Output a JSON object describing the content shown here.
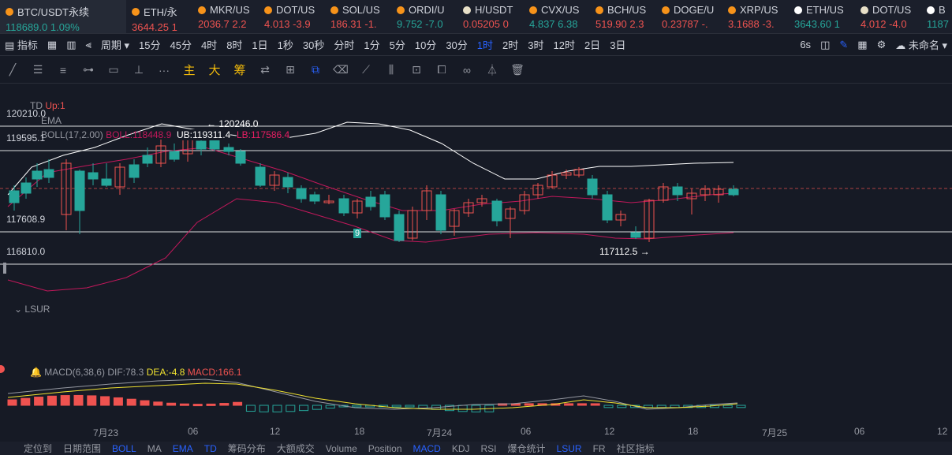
{
  "tickers": [
    {
      "name": "BTC/USDT永续",
      "price": "118689.0",
      "change": "1.09%",
      "dir": "up",
      "color": "#f7931a"
    },
    {
      "name": "ETH/永",
      "price": "3644.25",
      "change": "1",
      "dir": "dn",
      "color": "#f7931a"
    },
    {
      "name": "MKR/US",
      "price": "2036.7",
      "change": "2.2",
      "dir": "dn",
      "color": "#f7931a"
    },
    {
      "name": "DOT/US",
      "price": "4.013",
      "change": "-3.9",
      "dir": "dn",
      "color": "#f7931a"
    },
    {
      "name": "SOL/US",
      "price": "186.31",
      "change": "-1.",
      "dir": "dn",
      "color": "#f7931a"
    },
    {
      "name": "ORDI/U",
      "price": "9.752",
      "change": "-7.0",
      "dir": "up",
      "color": "#f7931a"
    },
    {
      "name": "H/USDT",
      "price": "0.05205",
      "change": "0",
      "dir": "dn",
      "color": "#e8e0c8"
    },
    {
      "name": "CVX/US",
      "price": "4.837",
      "change": "6.38",
      "dir": "up",
      "color": "#f7931a"
    },
    {
      "name": "BCH/US",
      "price": "519.90",
      "change": "2.3",
      "dir": "dn",
      "color": "#f7931a"
    },
    {
      "name": "DOGE/U",
      "price": "0.23787",
      "change": "-.",
      "dir": "dn",
      "color": "#f7931a"
    },
    {
      "name": "XRP/US",
      "price": "3.1688",
      "change": "-3.",
      "dir": "dn",
      "color": "#f7931a"
    },
    {
      "name": "ETH/US",
      "price": "3643.60",
      "change": "1",
      "dir": "up",
      "color": "#ffffff"
    },
    {
      "name": "DOT/US",
      "price": "4.012",
      "change": "-4.0",
      "dir": "dn",
      "color": "#e8e0c8"
    },
    {
      "name": "B",
      "price": "1187",
      "change": "",
      "dir": "up",
      "color": "#ffffff"
    }
  ],
  "toolbar": {
    "indicators": "指标",
    "period": "周期",
    "intervals": [
      "15分",
      "45分",
      "4时",
      "8时",
      "1日",
      "1秒",
      "30秒",
      "分时",
      "1分",
      "5分",
      "10分",
      "30分",
      "1时",
      "2时",
      "3时",
      "12时",
      "2日",
      "3日"
    ],
    "active_interval": "1时",
    "countdown": "6s",
    "layout_name": "未命名"
  },
  "drawing_tools": {
    "zh": [
      "主",
      "大",
      "筹"
    ]
  },
  "chart": {
    "price_labels": [
      "120210.0",
      "119595.1",
      "117608.9",
      "116810.0"
    ],
    "td_label": "TD",
    "td_value": "Up:1",
    "ema_label": "EMA",
    "boll_label": "BOLL(17,2.00)",
    "boll_text": "BOLL:118448.9",
    "ub": "UB:119311.4",
    "lb": "LB:117586.4",
    "high_annot": "← 120246.0",
    "low_annot": "117112.5 →",
    "td_count": "9",
    "lsur_label": "LSUR",
    "macd_label": "MACD(6,38,6)",
    "dif": "DIF:78.3",
    "dea": "DEA:-4.8",
    "macd": "MACD:166.1",
    "colors": {
      "up": "#26a69a",
      "down": "#ef5350",
      "boll_mid": "#c2185b",
      "boll_upper": "#ffffff",
      "dif": "#9598a1",
      "dea": "#f0e130"
    }
  },
  "x_axis": [
    "7月23",
    "06",
    "12",
    "18",
    "7月24",
    "06",
    "12",
    "18",
    "7月25",
    "06",
    "12"
  ],
  "bottom_tabs": [
    "定位到",
    "日期范围",
    "BOLL",
    "MA",
    "EMA",
    "TD",
    "筹码分布",
    "大额成交",
    "Volume",
    "Position",
    "MACD",
    "KDJ",
    "RSI",
    "爆仓统计",
    "LSUR",
    "FR",
    "社区指标"
  ],
  "bottom_active": [
    "BOLL",
    "EMA",
    "TD",
    "MACD",
    "LSUR"
  ]
}
